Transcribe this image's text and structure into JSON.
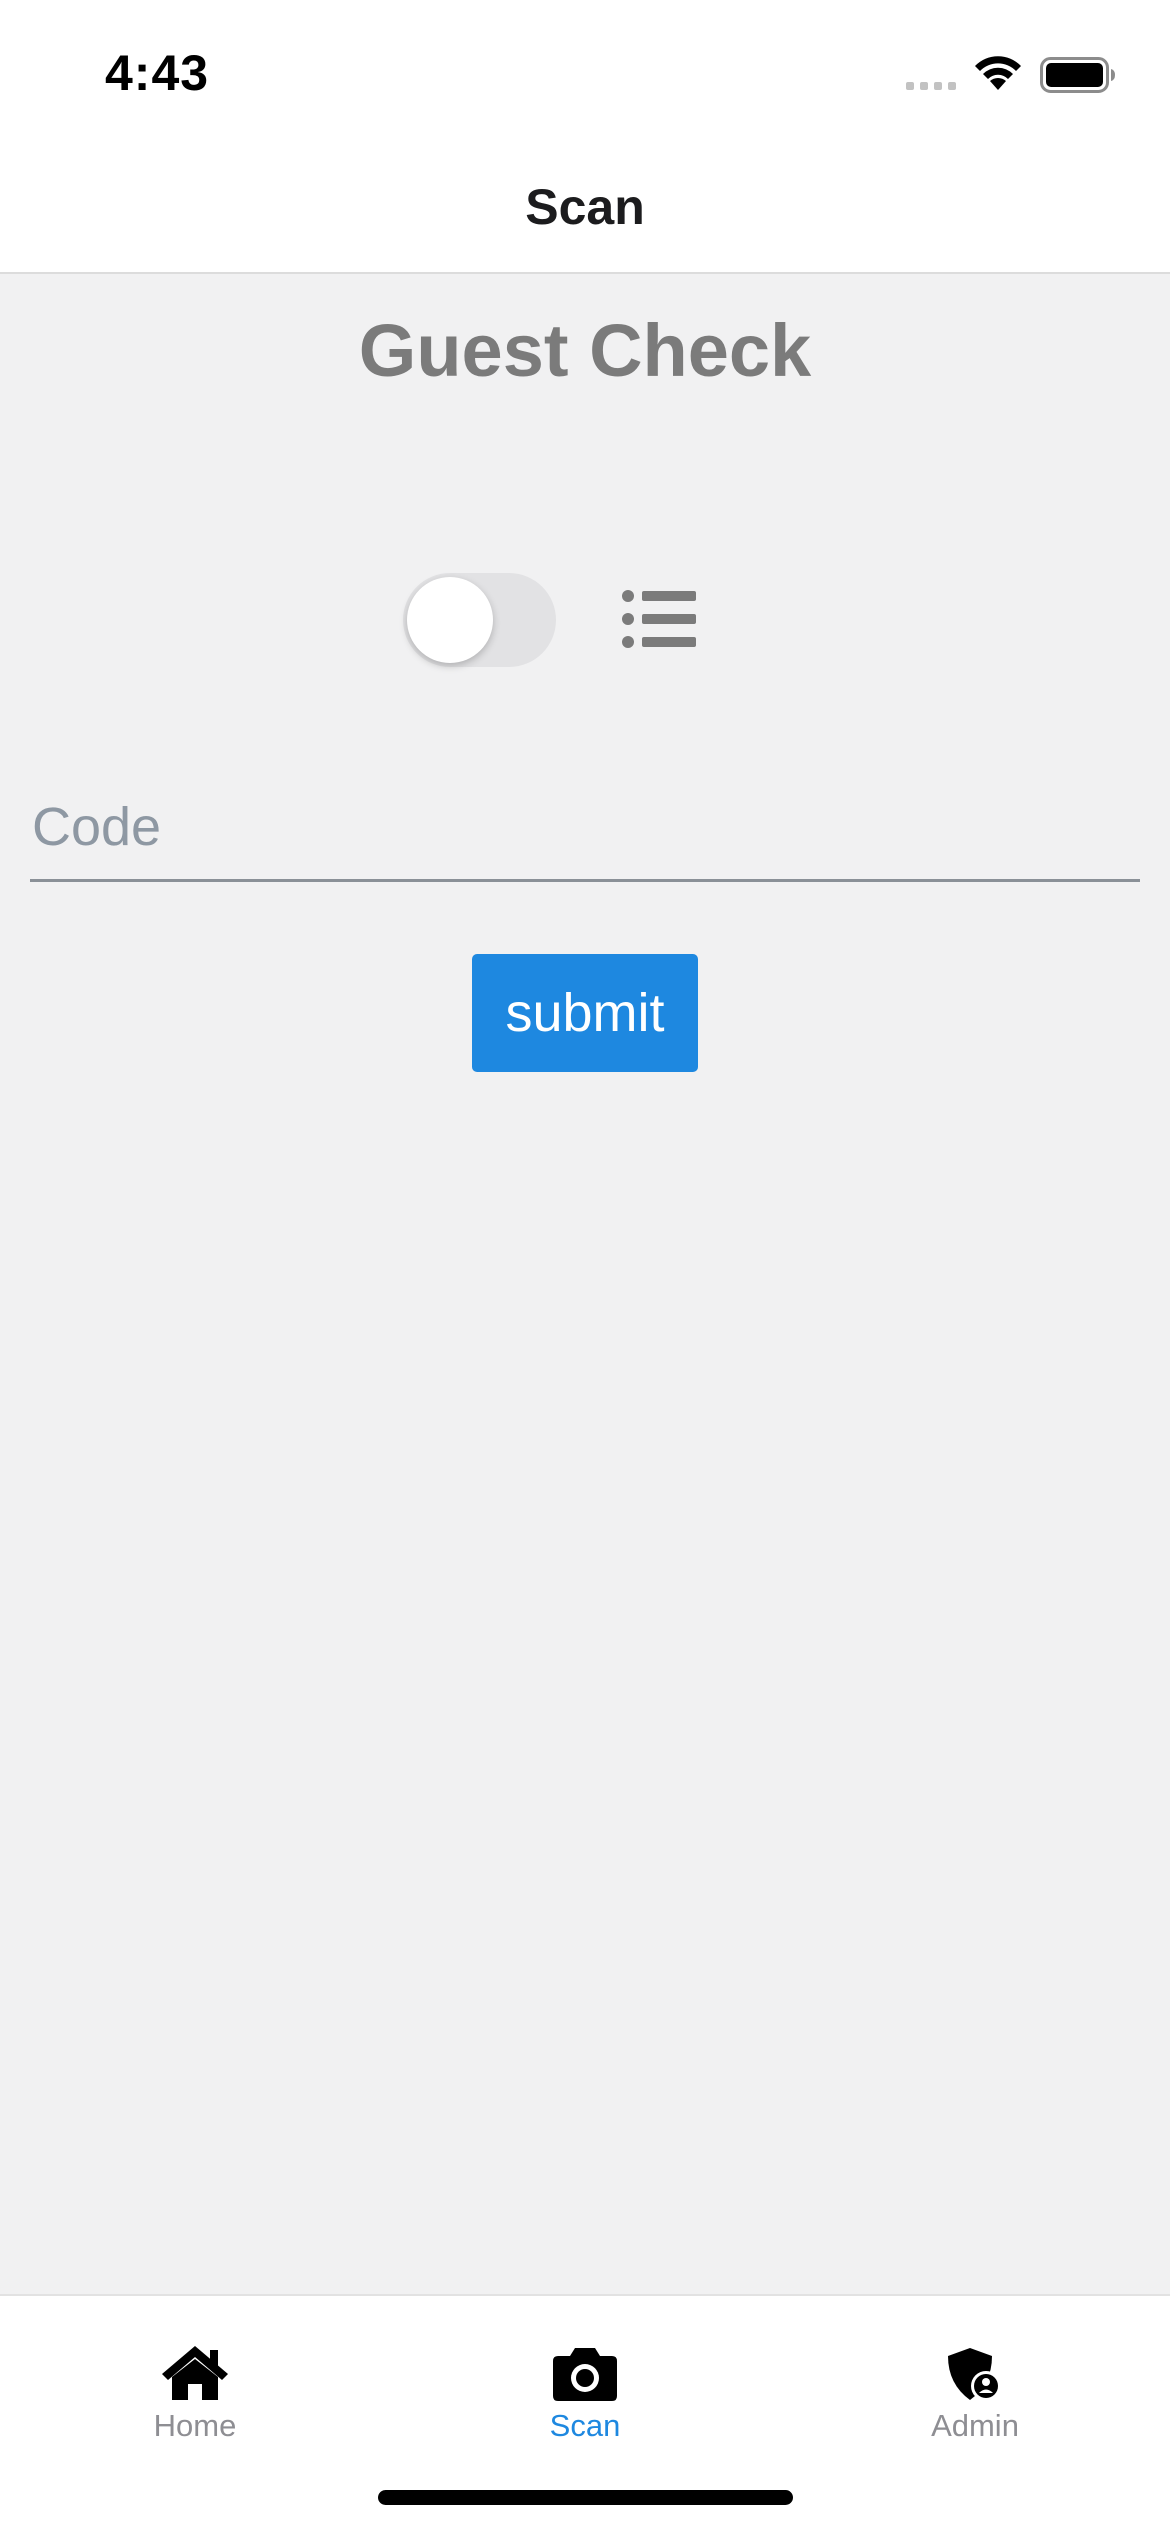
{
  "status_bar": {
    "time": "4:43"
  },
  "nav": {
    "title": "Scan"
  },
  "main": {
    "heading": "Guest Check",
    "toggle": {
      "state": "off"
    },
    "code_input": {
      "placeholder": "Code",
      "value": ""
    },
    "submit_label": "submit"
  },
  "tabs": [
    {
      "label": "Home",
      "icon": "home-icon",
      "active": false
    },
    {
      "label": "Scan",
      "icon": "camera-icon",
      "active": true
    },
    {
      "label": "Admin",
      "icon": "shield-user-icon",
      "active": false
    }
  ],
  "colors": {
    "accent": "#1e88e0",
    "background": "#f1f1f2",
    "heading": "#7b7b7b",
    "tab_inactive": "#8e8e93"
  }
}
